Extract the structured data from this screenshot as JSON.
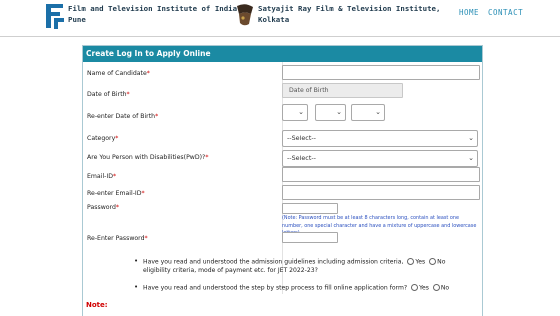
{
  "header": {
    "institute1_line1": "Film and Television Institute of India,",
    "institute1_line2": "Pune",
    "institute2_line1": "Satyajit Ray Film & Television Institute,",
    "institute2_line2": "Kolkata",
    "nav": [
      "HOME",
      "CONTACT"
    ]
  },
  "form": {
    "title": "Create Log In to Apply Online",
    "required_mark": "*",
    "labels": {
      "name": "Name of Candidate",
      "dob": "Date of Birth",
      "reenter_dob": "Re-enter Date of Birth",
      "category": "Category",
      "pwd": "Are You Person with Disabilities(PwD)?",
      "email": "Email-ID",
      "reenter_email": "Re-enter Email-ID",
      "password": "Password",
      "reenter_password": "Re-Enter Password"
    },
    "placeholders": {
      "dob": "Date of Birth"
    },
    "category_selected": "--Select--",
    "pwd_selected": "--Select--",
    "password_note": "(Note: Password must be at least 8 characters long, contain at least one number, one special character and have a mixture of uppercase and lowercase letters)",
    "question1_line1": "Have you read and understood the admission guidelines including admission criteria,",
    "question1_line2": "eligibility criteria, mode of payment etc. for JET 2022-23?",
    "question2": "Have you read and understood the step by step process to fill online application form?",
    "yes": "Yes",
    "no": "No",
    "note_label": "Note:"
  },
  "colors": {
    "header_bar": "#1b8aa3",
    "required": "#d00000",
    "note_text": "#2a4fbf",
    "nav": "#2b8fb6"
  }
}
